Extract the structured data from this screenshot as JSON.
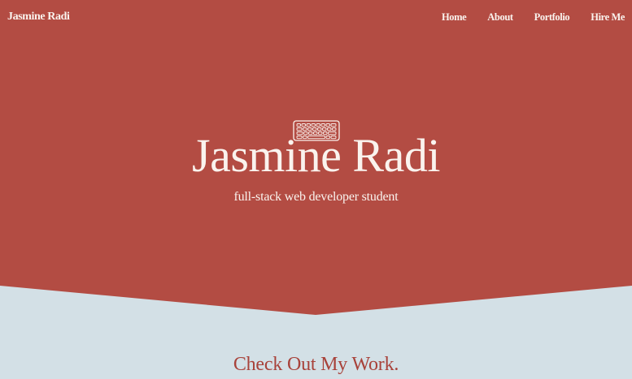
{
  "header": {
    "brand": "Jasmine Radi",
    "nav": [
      "Home",
      "About",
      "Portfolio",
      "Hire Me"
    ]
  },
  "hero": {
    "icon": "keyboard-icon",
    "title": "Jasmine Radi",
    "subtitle": "full-stack web developer student"
  },
  "work_section": {
    "heading": "Check Out My Work."
  },
  "colors": {
    "hero_background": "#b34c43",
    "page_background": "#d3e0e6",
    "hero_text": "#faf3ee",
    "accent_text": "#a8423a"
  }
}
